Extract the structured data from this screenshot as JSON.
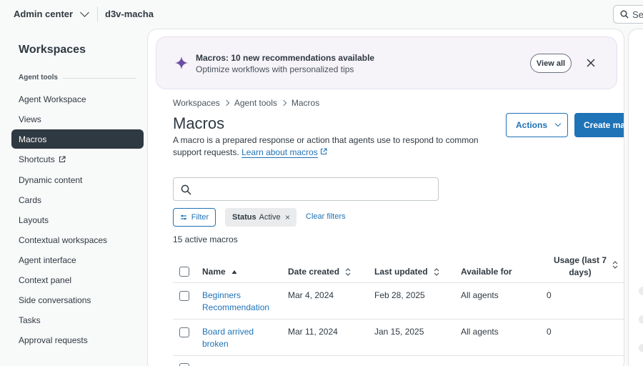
{
  "topbar": {
    "product": "Admin center",
    "subdomain": "d3v-macha",
    "search_placeholder": "Se"
  },
  "sidebar": {
    "title": "Workspaces",
    "section": "Agent tools",
    "items": [
      {
        "label": "Agent Workspace"
      },
      {
        "label": "Views"
      },
      {
        "label": "Macros"
      },
      {
        "label": "Shortcuts"
      },
      {
        "label": "Dynamic content"
      },
      {
        "label": "Cards"
      },
      {
        "label": "Layouts"
      },
      {
        "label": "Contextual workspaces"
      },
      {
        "label": "Agent interface"
      },
      {
        "label": "Context panel"
      },
      {
        "label": "Side conversations"
      },
      {
        "label": "Tasks"
      },
      {
        "label": "Approval requests"
      }
    ],
    "active_item": "Macros"
  },
  "banner": {
    "title": "Macros: 10 new recommendations available",
    "subtitle": "Optimize workflows with personalized tips",
    "view_all": "View all"
  },
  "breadcrumb": [
    "Workspaces",
    "Agent tools",
    "Macros"
  ],
  "page": {
    "title": "Macros",
    "description": "A macro is a prepared response or action that agents use to respond to common support requests.",
    "learn_more": "Learn about macros",
    "actions_label": "Actions",
    "create_label": "Create macro"
  },
  "filters": {
    "filter_label": "Filter",
    "chip_key": "Status",
    "chip_value": "Active",
    "clear_label": "Clear filters",
    "result_count": "15 active macros"
  },
  "table": {
    "columns": [
      "Name",
      "Date created",
      "Last updated",
      "Available for",
      "Usage (last 7 days)"
    ],
    "rows": [
      {
        "name": "Beginners Recommendation",
        "created": "Mar 4, 2024",
        "updated": "Feb 28, 2025",
        "available": "All agents",
        "usage": "0"
      },
      {
        "name": "Board arrived broken",
        "created": "Mar 11, 2024",
        "updated": "Jan 15, 2025",
        "available": "All agents",
        "usage": "0"
      }
    ]
  },
  "colors": {
    "accent": "#1f73b7",
    "dark": "#2f3941",
    "banner_bg": "#f6f3f9",
    "spark": "#6a4ea1"
  }
}
